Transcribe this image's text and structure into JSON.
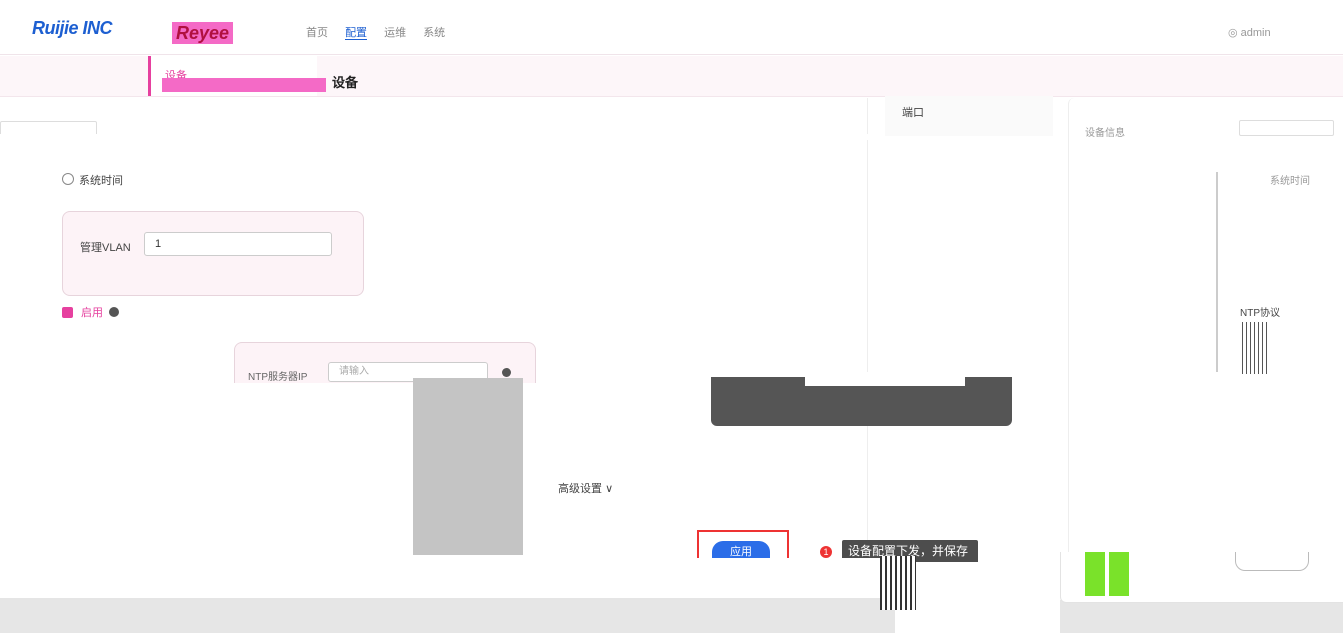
{
  "header": {
    "logo": "Ruijie INC",
    "brand": "Reyee",
    "nav": [
      "首页",
      "配置",
      "运维",
      "系统"
    ],
    "active_nav": "配置",
    "user": "admin",
    "user_icon": "user-icon"
  },
  "subnav": {
    "active_tab": "设备",
    "breadcrumb": "设备"
  },
  "side_panels": {
    "port_label": "端口",
    "right_label": "设备信息",
    "right_column_label": "系统时间",
    "ntp_label": "NTP协议"
  },
  "form": {
    "section_title": "系统时间",
    "mgmt_vlan_label": "管理VLAN",
    "mgmt_vlan_value": "1",
    "enable_label": "启用",
    "ntp_server_label": "NTP服务器IP",
    "ntp_server_placeholder": "请输入",
    "advanced_label": "高级设置",
    "apply_label": "应用"
  },
  "tooltip": {
    "badge": "1",
    "text": "设备配置下发，并保存"
  },
  "colors": {
    "accent": "#e6409f",
    "primary": "#2b6de8",
    "danger": "#e33333"
  }
}
